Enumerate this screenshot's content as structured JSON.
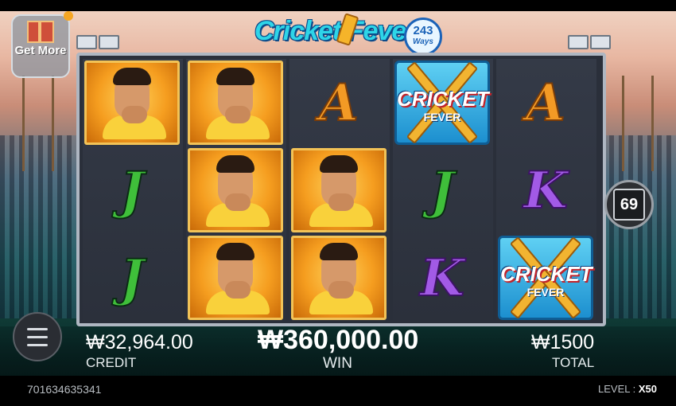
{
  "game": {
    "title": "Cricket Fever",
    "ways_number": "243",
    "ways_label": "Ways"
  },
  "get_more": {
    "label": "Get More"
  },
  "reels": [
    [
      "player",
      "J",
      "J"
    ],
    [
      "player",
      "player",
      "player"
    ],
    [
      "A",
      "player",
      "player"
    ],
    [
      "wild",
      "J",
      "K"
    ],
    [
      "A",
      "K",
      "wild"
    ]
  ],
  "wild_symbol": {
    "line1": "CRICKET",
    "line2": "FEVER"
  },
  "spin_counter": "69",
  "credit": {
    "value": "₩32,964.00",
    "label": "CREDIT"
  },
  "win": {
    "value": "₩360,000.00",
    "label": "WIN"
  },
  "total": {
    "value": "₩1500",
    "label": "TOTAL"
  },
  "footer": {
    "round_id": "701634635341",
    "level_label": "LEVEL :",
    "level_value": "X50"
  },
  "colors": {
    "letter_A": "#f39a25",
    "letter_J": "#3fbf3a",
    "letter_K": "#a25ae6",
    "player_bg": "#f59d1f",
    "wild_bg": "#1c8fcf"
  }
}
